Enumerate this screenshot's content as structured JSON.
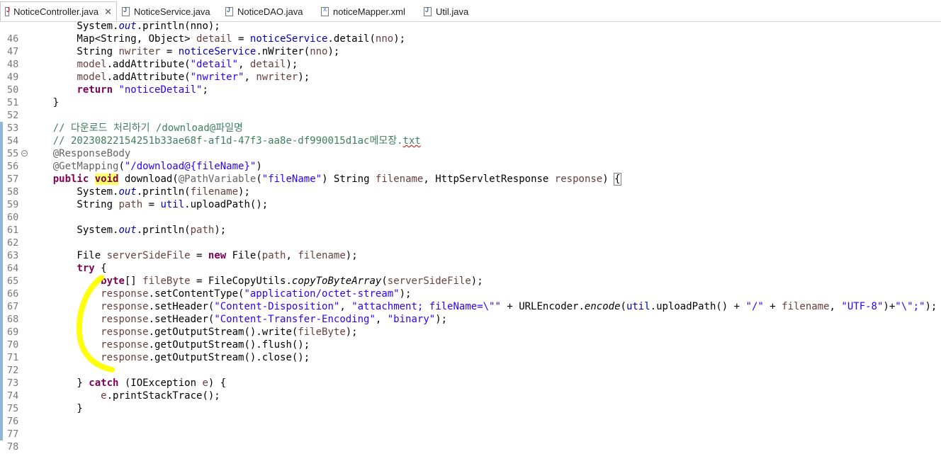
{
  "tabs": [
    {
      "label": "NoticeController.java",
      "icon": "java-controller-file-icon",
      "active": true
    },
    {
      "label": "NoticeService.java",
      "icon": "java-file-icon",
      "active": false
    },
    {
      "label": "NoticeDAO.java",
      "icon": "java-file-icon",
      "active": false
    },
    {
      "label": "noticeMapper.xml",
      "icon": "xml-file-icon",
      "active": false
    },
    {
      "label": "Util.java",
      "icon": "java-file-icon",
      "active": false
    }
  ],
  "close_glyph": "✕",
  "code": {
    "l46": {
      "num": "46",
      "a": "        System.",
      "b": "out",
      "c": ".println(nno);"
    },
    "l47": {
      "num": "47",
      "a": "        Map<String, Object> ",
      "b": "detail",
      "c": " = ",
      "d": "noticeService",
      "e": ".detail(",
      "f": "nno",
      "g": ");"
    },
    "l48": {
      "num": "48",
      "a": "        String ",
      "b": "nwriter",
      "c": " = ",
      "d": "noticeService",
      "e": ".nWriter(",
      "f": "nno",
      "g": ");"
    },
    "l49": {
      "num": "49",
      "a": "        ",
      "b": "model",
      "c": ".addAttribute(",
      "d": "\"detail\"",
      "e": ", ",
      "f": "detail",
      "g": ");"
    },
    "l50": {
      "num": "50",
      "a": "        ",
      "b": "model",
      "c": ".addAttribute(",
      "d": "\"nwriter\"",
      "e": ", ",
      "f": "nwriter",
      "g": ");"
    },
    "l51": {
      "num": "51",
      "a": "        ",
      "b": "return",
      "c": " ",
      "d": "\"noticeDetail\"",
      "e": ";"
    },
    "l52": {
      "num": "52",
      "a": "    }"
    },
    "l53": {
      "num": "53"
    },
    "l54": {
      "num": "54",
      "a": "    ",
      "b": "// 다운로드 처리하기 /download@파일명"
    },
    "l55": {
      "num": "55",
      "a": "    ",
      "b": "// 20230822154251b33ae68f-af1d-47f3-aa8e-df990015d1ac메모장.",
      "c": "txt"
    },
    "l56": {
      "num": "56",
      "a": "    ",
      "b": "@ResponseBody"
    },
    "l57": {
      "num": "57",
      "a": "    ",
      "b": "@GetMapping",
      "c": "(",
      "d": "\"/download@{fileName}\"",
      "e": ")"
    },
    "l58": {
      "num": "58",
      "a": "    ",
      "b": "public",
      "c": " ",
      "d": "void",
      "e": " download(",
      "f": "@PathVariable",
      "g": "(",
      "h": "\"fileName\"",
      "i": ") String ",
      "j": "filename",
      "k": ", HttpServletResponse ",
      "l": "response",
      "m": ") ",
      "n": "{"
    },
    "l59": {
      "num": "59",
      "a": "        System.",
      "b": "out",
      "c": ".println(",
      "d": "filename",
      "e": ");"
    },
    "l60": {
      "num": "60",
      "a": "        String ",
      "b": "path",
      "c": " = ",
      "d": "util",
      "e": ".uploadPath();"
    },
    "l61": {
      "num": "61"
    },
    "l62": {
      "num": "62",
      "a": "        System.",
      "b": "out",
      "c": ".println(",
      "d": "path",
      "e": ");"
    },
    "l63": {
      "num": "63"
    },
    "l64": {
      "num": "64",
      "a": "        File ",
      "b": "serverSideFile",
      "c": " = ",
      "d": "new",
      "e": " File(",
      "f": "path",
      "g": ", ",
      "h": "filename",
      "i": ");"
    },
    "l65": {
      "num": "65",
      "a": "        ",
      "b": "try",
      "c": " {"
    },
    "l66": {
      "num": "66",
      "a": "            ",
      "b": "byte",
      "c": "[] ",
      "d": "fileByte",
      "e": " = FileCopyUtils.",
      "f": "copyToByteArray",
      "g": "(",
      "h": "serverSideFile",
      "i": ");"
    },
    "l67": {
      "num": "67",
      "a": "            ",
      "b": "response",
      "c": ".setContentType(",
      "d": "\"application/octet-stream\"",
      "e": ");"
    },
    "l68": {
      "num": "68",
      "a": "            ",
      "b": "response",
      "c": ".setHeader(",
      "d": "\"Content-Disposition\"",
      "e": ", ",
      "f": "\"attachment; fileName=\\\"\"",
      "g": " + URLEncoder.",
      "h": "encode",
      "i": "(",
      "j": "util",
      "k": ".uploadPath() + ",
      "l": "\"/\"",
      "m": " + ",
      "n": "filename",
      "o": ", ",
      "p": "\"UTF-8\"",
      "q": ")+",
      "r": "\"\\\";\"",
      "s": ");"
    },
    "l69": {
      "num": "69",
      "a": "            ",
      "b": "response",
      "c": ".setHeader(",
      "d": "\"Content-Transfer-Encoding\"",
      "e": ", ",
      "f": "\"binary\"",
      "g": ");"
    },
    "l70": {
      "num": "70",
      "a": "            ",
      "b": "response",
      "c": ".getOutputStream().write(",
      "d": "fileByte",
      "e": ");"
    },
    "l71": {
      "num": "71",
      "a": "            ",
      "b": "response",
      "c": ".getOutputStream().flush();"
    },
    "l72": {
      "num": "72",
      "a": "            ",
      "b": "response",
      "c": ".getOutputStream().close();"
    },
    "l73": {
      "num": "73"
    },
    "l74": {
      "num": "74",
      "a": "        } ",
      "b": "catch",
      "c": " (IOException ",
      "d": "e",
      "e": ") {"
    },
    "l75": {
      "num": "75",
      "a": "            ",
      "b": "e",
      "c": ".printStackTrace();"
    },
    "l76": {
      "num": "76",
      "a": "        }"
    },
    "l77": {
      "num": "77"
    },
    "l78": {
      "num": "78"
    }
  },
  "colors": {
    "keyword": "#7f0055",
    "string": "#2a00ff",
    "field": "#0000c0",
    "comment": "#3f7f5f",
    "annotation": "#646464",
    "local_variable": "#6a3e3e",
    "highlight_marker": "#ffff00"
  }
}
